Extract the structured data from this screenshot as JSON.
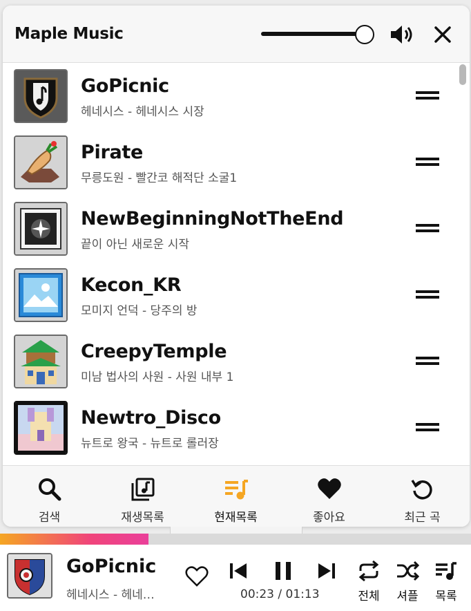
{
  "app": {
    "title": "Maple Music",
    "volume": 1.0
  },
  "playlist": [
    {
      "title": "GoPicnic",
      "subtitle": "헤네시스 - 헤네시스 시장",
      "art": "shield-music-icon"
    },
    {
      "title": "Pirate",
      "subtitle": "무릉도원 - 빨간코 해적단 소굴1",
      "art": "ginseng-icon"
    },
    {
      "title": "NewBeginningNotTheEnd",
      "subtitle": "끝이 아닌 새로운 시작",
      "art": "compass-icon"
    },
    {
      "title": "Kecon_KR",
      "subtitle": "모미지 언덕 - 당주의 방",
      "art": "landscape-icon"
    },
    {
      "title": "CreepyTemple",
      "subtitle": "미남 법사의 사원 - 사원 내부 1",
      "art": "temple-icon"
    },
    {
      "title": "Newtro_Disco",
      "subtitle": "뉴트로 왕국 - 뉴트로 롤러장",
      "art": "castle-icon"
    }
  ],
  "tabs": [
    {
      "label": "검색",
      "icon": "search-icon",
      "active": false
    },
    {
      "label": "재생목록",
      "icon": "playlist-icon",
      "active": false
    },
    {
      "label": "현재목록",
      "icon": "queue-icon",
      "active": true
    },
    {
      "label": "좋아요",
      "icon": "heart-icon",
      "active": false
    },
    {
      "label": "최근 곡",
      "icon": "history-icon",
      "active": false
    }
  ],
  "player": {
    "title": "GoPicnic",
    "subtitle": "헤네시스 - 헤네…",
    "current_time": "00:23",
    "separator": " / ",
    "duration": "01:13",
    "progress": 0.315,
    "repeat_label": "전체",
    "shuffle_label": "셔플",
    "list_label": "목록"
  },
  "colors": {
    "accent": "#f5a623",
    "progress_end": "#ea3f9a"
  }
}
